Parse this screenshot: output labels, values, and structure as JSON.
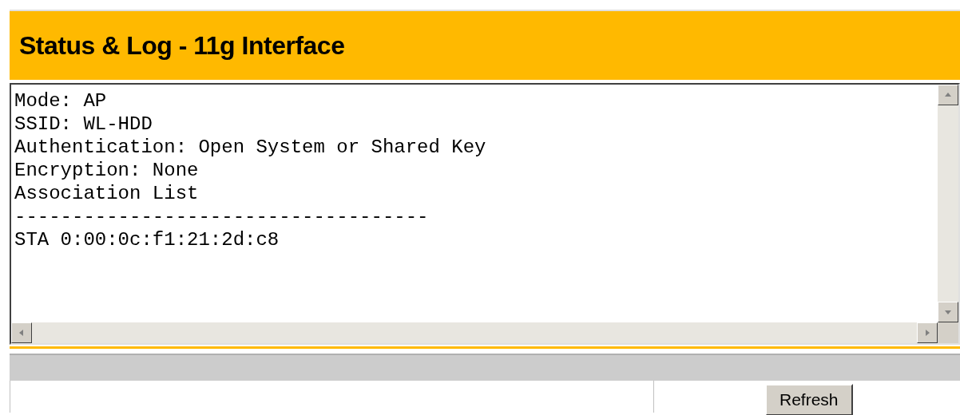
{
  "header": {
    "title": "Status & Log - 11g Interface"
  },
  "log": {
    "lines": [
      "Mode: AP",
      "SSID: WL-HDD",
      "Authentication: Open System or Shared Key",
      "Encryption: None",
      "Association List",
      "------------------------------------",
      "STA 0:00:0c:f1:21:2d:c8"
    ]
  },
  "buttons": [
    {
      "label": "Refresh"
    }
  ]
}
